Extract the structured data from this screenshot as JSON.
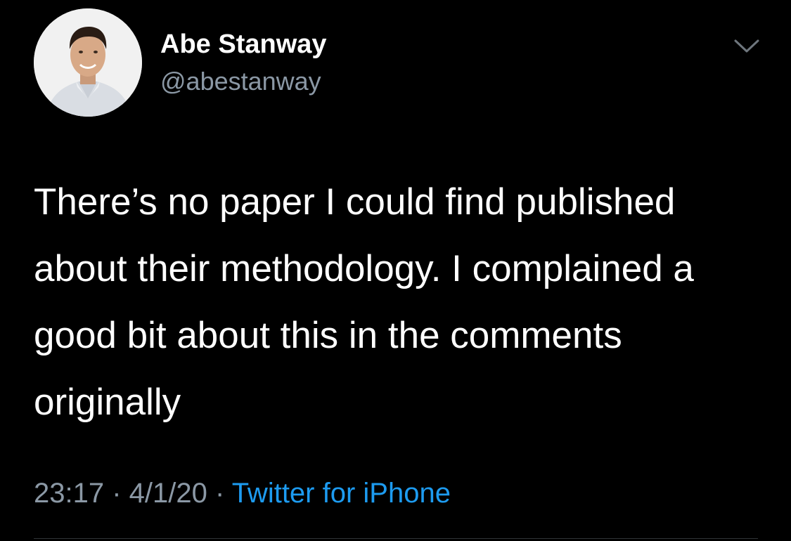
{
  "author": {
    "display_name": "Abe Stanway",
    "handle": "@abestanway",
    "avatar_icon": "profile-photo"
  },
  "tweet": {
    "text": "There’s no paper I could find published about their methodology. I complained a good bit about this in the comments originally",
    "time": "23:17",
    "separator_1": " · ",
    "date": "4/1/20",
    "separator_2": " · ",
    "source": "Twitter for iPhone"
  },
  "menu": {
    "icon": "chevron-down-icon"
  },
  "colors": {
    "background": "#000000",
    "text": "#ffffff",
    "muted": "#8b98a5",
    "link": "#1d9bf0"
  }
}
